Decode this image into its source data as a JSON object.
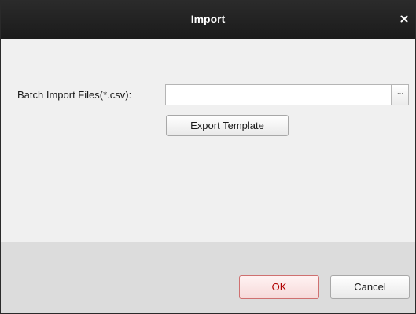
{
  "dialog": {
    "title": "Import",
    "close_icon": "close-icon"
  },
  "form": {
    "label": "Batch Import Files(*.csv):",
    "file_value": "",
    "file_placeholder": "",
    "browse_label": "···",
    "export_label": "Export Template"
  },
  "footer": {
    "ok_label": "OK",
    "cancel_label": "Cancel"
  },
  "colors": {
    "titlebar": "#1f1f1f",
    "body": "#f0f0f0",
    "footer": "#dcdcdc",
    "ok_accent": "#cf7070"
  }
}
